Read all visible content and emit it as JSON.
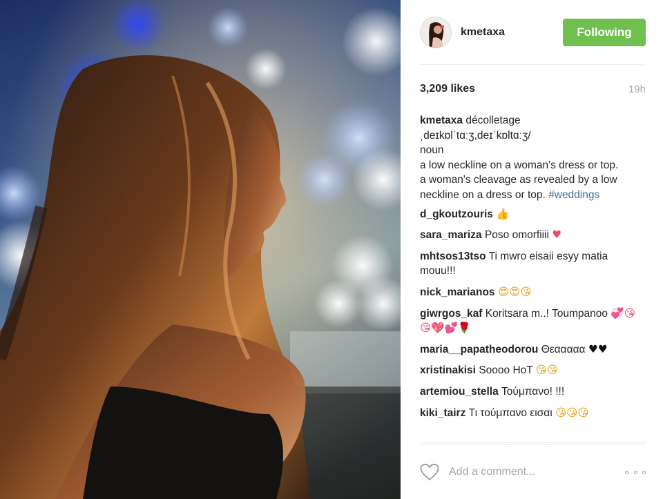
{
  "post": {
    "author": "kmetaxa",
    "follow_label": "Following",
    "likes": "3,209 likes",
    "time": "19h",
    "caption": {
      "user": "kmetaxa",
      "lines": [
        "décolletage",
        "ˌdeɪkɒlˈtɑːʒ,deɪˈkɒltɑːʒ/",
        "noun",
        "a low neckline on a woman's dress or top.",
        "a woman's cleavage as revealed by a low neckline on a dress or top."
      ],
      "hashtag": "#weddings"
    },
    "comments": [
      {
        "user": "d_gkoutzouris",
        "text": "",
        "emoji": "👍"
      },
      {
        "user": "sara_mariza",
        "text": "Poso omorfiiii",
        "emoji": "♥"
      },
      {
        "user": "mhtsos13tso",
        "text": "Ti mwro eisaii esyy matia mouu!!!",
        "emoji": ""
      },
      {
        "user": "nick_marianos",
        "text": "",
        "emoji": "😍😍😘"
      },
      {
        "user": "giwrgos_kaf",
        "text": "Koritsara m..! Toumpanoo",
        "emoji": "💞😘😘💖💕🌹"
      },
      {
        "user": "maria__papatheodorou",
        "text": "Θεααααα",
        "emoji": "♥♥"
      },
      {
        "user": "xristinakisi",
        "text": "Soooo HoT",
        "emoji": "😘😘"
      },
      {
        "user": "artemiou_stella",
        "text": "Τούμπανο! !!!",
        "emoji": ""
      },
      {
        "user": "kiki_tairz",
        "text": "Τι τούμπανο εισαι",
        "emoji": "😘😘😘"
      }
    ],
    "add_comment_placeholder": "Add a comment...",
    "icons": {
      "like": "heart-icon",
      "more": "more-options-icon"
    },
    "colors": {
      "follow_button": "#70c050",
      "hashtag": "#3f729b",
      "heart_emoji": "#ed4a6a"
    }
  }
}
